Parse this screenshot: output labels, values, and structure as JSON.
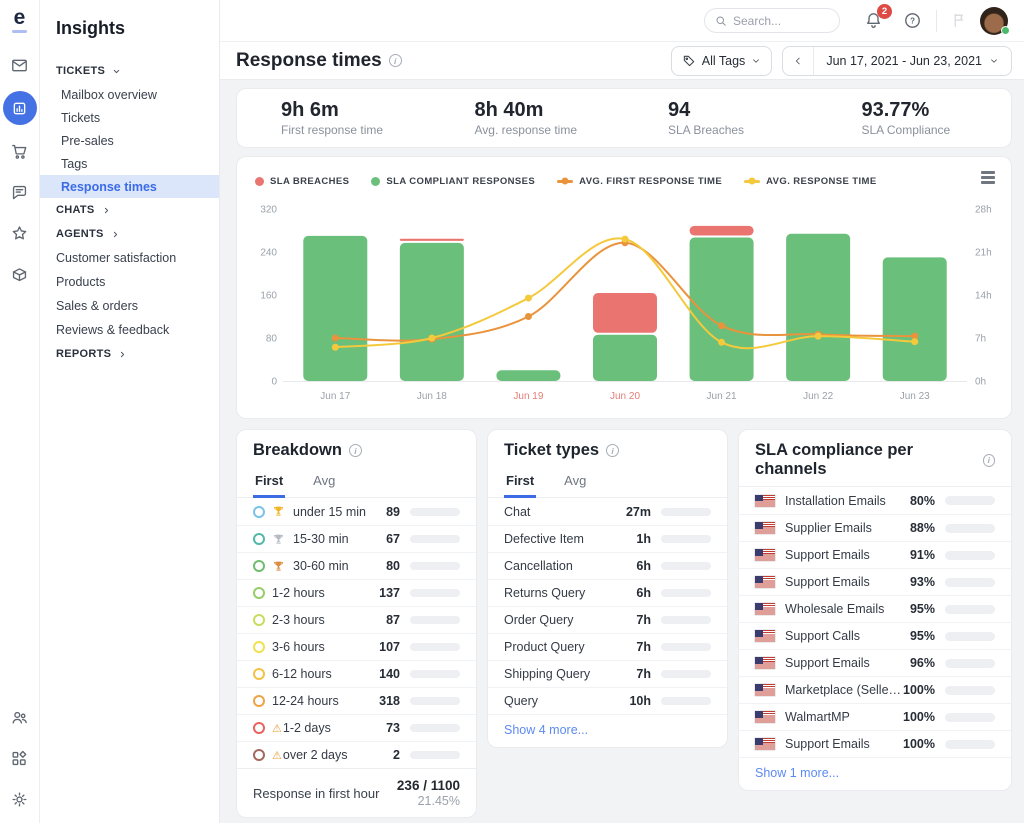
{
  "rail": {
    "logo_letter": "e",
    "items": [
      {
        "name": "mail-icon",
        "active": false
      },
      {
        "name": "insights-icon",
        "active": true
      },
      {
        "name": "orders-icon",
        "active": false
      },
      {
        "name": "chat-icon",
        "active": false
      },
      {
        "name": "reviews-icon",
        "active": false
      },
      {
        "name": "products-icon",
        "active": false
      }
    ],
    "bottom_items": [
      {
        "name": "users-icon"
      },
      {
        "name": "apps-icon"
      },
      {
        "name": "settings-icon"
      }
    ]
  },
  "sidebar": {
    "title": "Insights",
    "items": [
      {
        "label": "TICKETS",
        "type": "section",
        "chevron": "down"
      },
      {
        "label": "Mailbox overview",
        "type": "link"
      },
      {
        "label": "Tickets",
        "type": "link"
      },
      {
        "label": "Pre-sales",
        "type": "link"
      },
      {
        "label": "Tags",
        "type": "link"
      },
      {
        "label": "Response times",
        "type": "link",
        "active": true
      },
      {
        "label": "CHATS",
        "type": "section",
        "chevron": "right"
      },
      {
        "label": "AGENTS",
        "type": "section",
        "chevron": "right"
      },
      {
        "label": "Customer satisfaction",
        "type": "item"
      },
      {
        "label": "Products",
        "type": "item"
      },
      {
        "label": "Sales & orders",
        "type": "item"
      },
      {
        "label": "Reviews & feedback",
        "type": "item"
      },
      {
        "label": "REPORTS",
        "type": "section",
        "chevron": "right"
      }
    ]
  },
  "topbar": {
    "search_placeholder": "Search...",
    "notification_count": "2"
  },
  "header": {
    "title": "Response times",
    "all_tags": "All Tags",
    "date_range": "Jun 17, 2021 - Jun 23, 2021"
  },
  "kpis": [
    {
      "value": "9h 6m",
      "label": "First response time"
    },
    {
      "value": "8h 40m",
      "label": "Avg. response time"
    },
    {
      "value": "94",
      "label": "SLA Breaches"
    },
    {
      "value": "93.77%",
      "label": "SLA Compliance"
    }
  ],
  "chart_data": {
    "type": "bar+line combo",
    "categories": [
      "Jun 17",
      "Jun 18",
      "Jun 19",
      "Jun 20",
      "Jun 21",
      "Jun 22",
      "Jun 23"
    ],
    "highlighted_categories": [
      "Jun 19",
      "Jun 20"
    ],
    "series": [
      {
        "name": "SLA BREACHES",
        "type": "bar",
        "color": "#e97470",
        "values": [
          0,
          4,
          0,
          74,
          18,
          0,
          0
        ]
      },
      {
        "name": "SLA COMPLIANT RESPONSES",
        "type": "bar",
        "color": "#6abf7b",
        "values": [
          270,
          257,
          20,
          86,
          267,
          274,
          230
        ]
      },
      {
        "name": "AVG. FIRST RESPONSE TIME",
        "type": "line",
        "unit": "hours",
        "color": "#e9943d",
        "values": [
          7,
          6.8,
          10.5,
          22.5,
          9,
          7.6,
          7.3
        ]
      },
      {
        "name": "AVG. RESPONSE TIME",
        "type": "line",
        "unit": "hours",
        "color": "#f4c93c",
        "values": [
          5.5,
          7,
          13.5,
          23.1,
          6.3,
          7.3,
          6.4
        ]
      }
    ],
    "left_axis": {
      "ticks": [
        0,
        80,
        160,
        240,
        320
      ],
      "max": 320
    },
    "right_axis": {
      "ticks": [
        "0h",
        "7h",
        "14h",
        "21h",
        "28h"
      ],
      "tick_hours": [
        0,
        7,
        14,
        21,
        28
      ],
      "max_hours": 28
    },
    "legend_position": "top",
    "grid": false
  },
  "breakdown": {
    "title": "Breakdown",
    "tabs": [
      {
        "label": "First",
        "active": true
      },
      {
        "label": "Avg",
        "active": false
      }
    ],
    "max_value": 318,
    "rows": [
      {
        "label": "under 15 min",
        "value": 89,
        "circle_color": "#79c3e8",
        "medal": "gold"
      },
      {
        "label": "15-30 min",
        "value": 67,
        "circle_color": "#52b8a8",
        "medal": "silver"
      },
      {
        "label": "30-60 min",
        "value": 80,
        "circle_color": "#6fbe6f",
        "medal": "bronze"
      },
      {
        "label": "1-2 hours",
        "value": 137,
        "circle_color": "#97cd68"
      },
      {
        "label": "2-3 hours",
        "value": 87,
        "circle_color": "#c9dd5d"
      },
      {
        "label": "3-6 hours",
        "value": 107,
        "circle_color": "#f0e14e"
      },
      {
        "label": "6-12 hours",
        "value": 140,
        "circle_color": "#f4c243"
      },
      {
        "label": "12-24 hours",
        "value": 318,
        "circle_color": "#f0a345"
      },
      {
        "label": "1-2 days",
        "value": 73,
        "circle_color": "#e8635c",
        "warning": true
      },
      {
        "label": "over 2 days",
        "value": 2,
        "circle_color": "#a5685f",
        "warning": true
      }
    ],
    "footer": {
      "label": "Response in first hour",
      "value": "236 / 1100",
      "percent": "21.45%"
    }
  },
  "ticket_types": {
    "title": "Ticket types",
    "tabs": [
      {
        "label": "First",
        "active": true
      },
      {
        "label": "Avg",
        "active": false
      }
    ],
    "bar_max_hours": 13.5,
    "rows": [
      {
        "label": "Chat",
        "value": "27m",
        "hours": 0.45
      },
      {
        "label": "Defective Item",
        "value": "1h",
        "hours": 1
      },
      {
        "label": "Cancellation",
        "value": "6h",
        "hours": 6
      },
      {
        "label": "Returns Query",
        "value": "6h",
        "hours": 6
      },
      {
        "label": "Order Query",
        "value": "7h",
        "hours": 7
      },
      {
        "label": "Product Query",
        "value": "7h",
        "hours": 7
      },
      {
        "label": "Shipping Query",
        "value": "7h",
        "hours": 7
      },
      {
        "label": "Query",
        "value": "10h",
        "hours": 10
      }
    ],
    "show_more": "Show 4 more..."
  },
  "sla_channels": {
    "title": "SLA compliance per channels",
    "flag": "us-flag",
    "green_threshold": 93,
    "colors": {
      "orange": "#eb9d4e",
      "green": "#7bc987"
    },
    "rows": [
      {
        "label": "Installation Emails",
        "percent": 80
      },
      {
        "label": "Supplier Emails",
        "percent": 88
      },
      {
        "label": "Support Emails",
        "percent": 91
      },
      {
        "label": "Support Emails",
        "percent": 93
      },
      {
        "label": "Wholesale Emails",
        "percent": 95
      },
      {
        "label": "Support Calls",
        "percent": 95
      },
      {
        "label": "Support Emails",
        "percent": 96
      },
      {
        "label": "Marketplace (SellerCentral)",
        "percent": 100
      },
      {
        "label": "WalmartMP",
        "percent": 100
      },
      {
        "label": "Support Emails",
        "percent": 100
      }
    ],
    "show_more": "Show 1 more..."
  }
}
